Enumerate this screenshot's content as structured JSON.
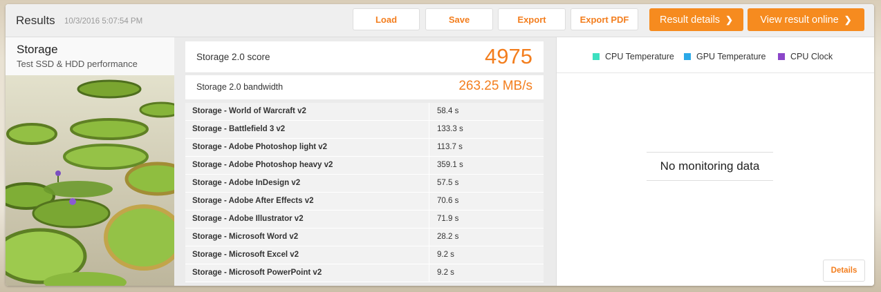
{
  "header": {
    "title": "Results",
    "timestamp": "10/3/2016 5:07:54 PM",
    "buttons": {
      "load": "Load",
      "save": "Save",
      "export": "Export",
      "export_pdf": "Export PDF",
      "result_details": "Result details",
      "view_online": "View result online"
    }
  },
  "test": {
    "name": "Storage",
    "description": "Test SSD & HDD performance"
  },
  "score": {
    "label": "Storage 2.0 score",
    "value": "4975"
  },
  "bandwidth": {
    "label": "Storage 2.0 bandwidth",
    "value": "263.25 MB/s"
  },
  "subtests": [
    {
      "name": "Storage - World of Warcraft v2",
      "time": "58.4 s"
    },
    {
      "name": "Storage - Battlefield 3 v2",
      "time": "133.3 s"
    },
    {
      "name": "Storage - Adobe Photoshop light v2",
      "time": "113.7 s"
    },
    {
      "name": "Storage - Adobe Photoshop heavy v2",
      "time": "359.1 s"
    },
    {
      "name": "Storage - Adobe InDesign v2",
      "time": "57.5 s"
    },
    {
      "name": "Storage - Adobe After Effects v2",
      "time": "70.6 s"
    },
    {
      "name": "Storage - Adobe Illustrator v2",
      "time": "71.9 s"
    },
    {
      "name": "Storage - Microsoft Word v2",
      "time": "28.2 s"
    },
    {
      "name": "Storage - Microsoft Excel v2",
      "time": "9.2 s"
    },
    {
      "name": "Storage - Microsoft PowerPoint v2",
      "time": "9.2 s"
    }
  ],
  "monitoring": {
    "legend": [
      {
        "label": "CPU Temperature",
        "color": "#3de0c0"
      },
      {
        "label": "GPU Temperature",
        "color": "#2ba9e8"
      },
      {
        "label": "CPU Clock",
        "color": "#8b46c9"
      }
    ],
    "empty_message": "No monitoring data",
    "details_label": "Details"
  },
  "colors": {
    "accent": "#f37e1e",
    "button_orange": "#f68b1f"
  }
}
